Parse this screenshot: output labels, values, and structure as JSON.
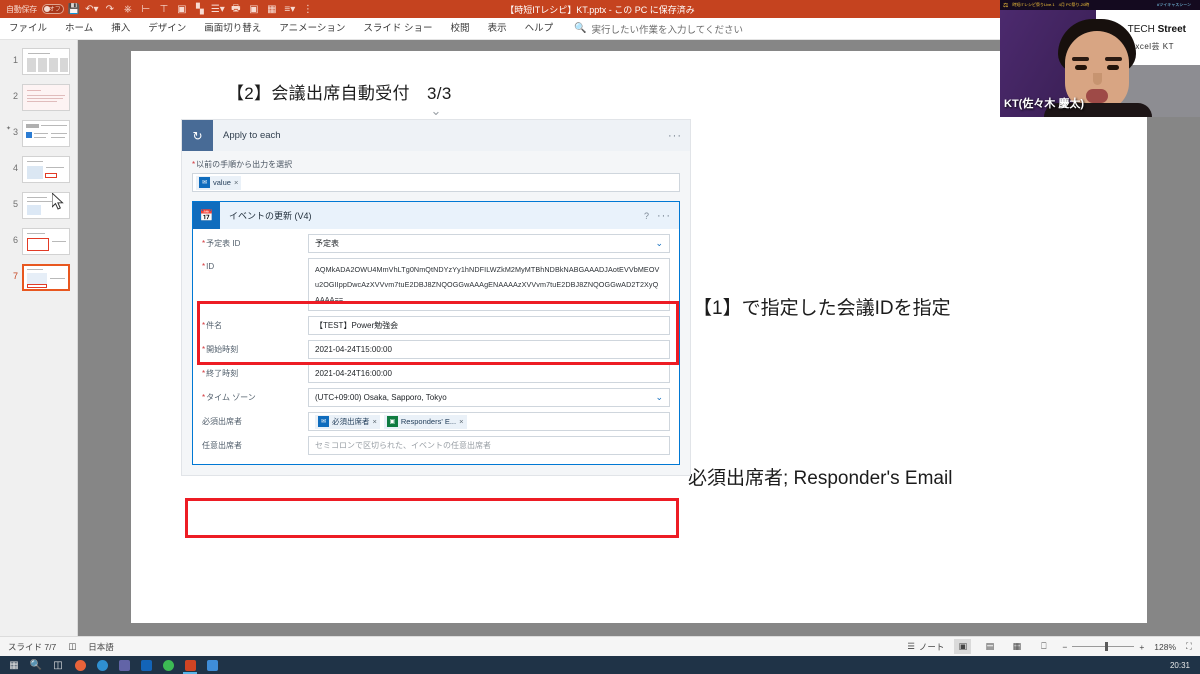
{
  "titlebar": {
    "autosave_label": "自動保存",
    "autosave_state": "オフ",
    "document_title": "【時短ITレシピ】KT.pptx - この PC に保存済み",
    "qat_icons": [
      "save-icon",
      "undo-icon",
      "redo-icon",
      "start-slideshow-icon",
      "align-icon",
      "text-direction-icon",
      "picture-icon",
      "chart-icon",
      "list-icon",
      "print-icon",
      "customize-icon"
    ]
  },
  "ribbon": {
    "tabs": [
      {
        "label": "ファイル",
        "name": "tab-file"
      },
      {
        "label": "ホーム",
        "name": "tab-home"
      },
      {
        "label": "挿入",
        "name": "tab-insert"
      },
      {
        "label": "デザイン",
        "name": "tab-design"
      },
      {
        "label": "画面切り替え",
        "name": "tab-transitions"
      },
      {
        "label": "アニメーション",
        "name": "tab-animations"
      },
      {
        "label": "スライド ショー",
        "name": "tab-slideshow"
      },
      {
        "label": "校閲",
        "name": "tab-review"
      },
      {
        "label": "表示",
        "name": "tab-view"
      },
      {
        "label": "ヘルプ",
        "name": "tab-help"
      }
    ],
    "tellme_placeholder": "実行したい作業を入力してください"
  },
  "thumbnails": {
    "slides": [
      {
        "number": "1",
        "animated": false,
        "selected": false
      },
      {
        "number": "2",
        "animated": true,
        "selected": false
      },
      {
        "number": "3",
        "animated": false,
        "selected": false
      },
      {
        "number": "4",
        "animated": false,
        "selected": false
      },
      {
        "number": "5",
        "animated": false,
        "selected": false
      },
      {
        "number": "6",
        "animated": false,
        "selected": false
      },
      {
        "number": "7",
        "animated": false,
        "selected": true
      }
    ]
  },
  "slide": {
    "title": "【2】会議出席自動受付　3/3",
    "annotation_id": "【1】で指定した会議IDを指定",
    "annotation_attendees": "必須出席者; Responder's Email",
    "highlight_color": "#ed1c24"
  },
  "flow": {
    "outer_card": {
      "title": "Apply to each",
      "icon": "loop-icon",
      "menu": "···",
      "field_label": "以前の手順から出力を選択",
      "token": {
        "text": "value",
        "remove": "×",
        "icon": "outlook-icon"
      }
    },
    "inner_card": {
      "title": "イベントの更新 (V4)",
      "icon": "outlook-calendar-icon",
      "help": "?",
      "menu": "···",
      "rows": [
        {
          "label": "予定表 ID",
          "required": true,
          "value": "予定表",
          "type": "dropdown"
        },
        {
          "label": "ID",
          "required": true,
          "value": "AQMkADA2OWU4MmVhLTg0NmQtNDYzYy1hNDFILWZkM2MyMTBhNDBkNABGAAADJAotEVVbMEOVu2OGIIppDwcAzXVVvm7tuE2DBJ8ZNQOGGwAAAgENAAAAzXVVvm7tuE2DBJ8ZNQOGGwAD2T2XyQAAAA==",
          "type": "textarea"
        },
        {
          "label": "件名",
          "required": true,
          "value": "【TEST】Power勉強会",
          "type": "text"
        },
        {
          "label": "開始時刻",
          "required": true,
          "value": "2021-04-24T15:00:00",
          "type": "text"
        },
        {
          "label": "終了時刻",
          "required": true,
          "value": "2021-04-24T16:00:00",
          "type": "text"
        },
        {
          "label": "タイム ゾーン",
          "required": true,
          "value": "(UTC+09:00) Osaka, Sapporo, Tokyo",
          "type": "dropdown"
        }
      ],
      "attendees_row": {
        "label": "必須出席者",
        "tokens": [
          {
            "text": "必須出席者",
            "remove": "×",
            "icon": "outlook-icon"
          },
          {
            "text": "Responders' E...",
            "remove": "×",
            "icon": "forms-icon"
          }
        ]
      },
      "optional_row": {
        "label": "任意出席者",
        "placeholder": "セミコロンで区切られた、イベントの任意出席者"
      }
    }
  },
  "statusbar": {
    "slide_counter": "スライド 7/7",
    "language": "日本語",
    "notes_label": "ノート",
    "zoom_level": "128%",
    "zoom_out": "−",
    "zoom_in": "+",
    "views": [
      "normal-view",
      "slide-sorter-view",
      "reading-view",
      "slideshow-view"
    ],
    "fit_label": "スライドを現在のウィンドウに合わせる"
  },
  "taskbar": {
    "clock": "20:31",
    "apps": [
      {
        "name": "start-button",
        "color": "#ffffff"
      },
      {
        "name": "search-icon",
        "color": "#e6e6e6"
      },
      {
        "name": "task-view-icon",
        "color": "#e6e6e6"
      },
      {
        "name": "chrome-icon",
        "color": "#e8633a"
      },
      {
        "name": "edge-icon",
        "color": "#2f8fd0"
      },
      {
        "name": "teams-icon",
        "color": "#6264a7"
      },
      {
        "name": "outlook-icon",
        "color": "#1364b8"
      },
      {
        "name": "chrome-alt-icon",
        "color": "#3cba54"
      },
      {
        "name": "powerpoint-icon",
        "color": "#d04423"
      },
      {
        "name": "app-window-icon",
        "color": "#3f8dd8"
      }
    ]
  },
  "webcam": {
    "topbar_text": "時短ITレシピ祭りLive.1　4月 PC祭り-20時",
    "topbar_twitter": "#ツイキャスシーン",
    "brand_line1_light": "TECH ",
    "brand_line1_bold": "Street",
    "brand_line2": "Excel芸 KT",
    "name_label": "KT(佐々木 慶太)"
  }
}
